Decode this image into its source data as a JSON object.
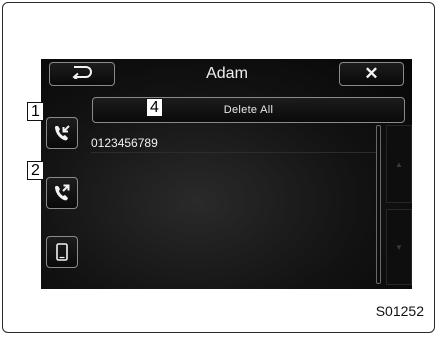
{
  "header": {
    "title": "Adam",
    "back_icon": "return-arrow-icon",
    "close_icon": "close-x-icon",
    "close_glyph": "✕"
  },
  "toolbar": {
    "delete_all_label": "Delete All"
  },
  "sidebar": {
    "items": [
      {
        "icon": "incoming-call-icon",
        "callout": "1"
      },
      {
        "icon": "outgoing-call-icon",
        "callout": "2"
      },
      {
        "icon": "phone-device-icon"
      }
    ]
  },
  "list": {
    "items": [
      {
        "number": "0123456789"
      }
    ]
  },
  "scroll": {
    "up_glyph": "▲",
    "down_glyph": "▼"
  },
  "callouts": {
    "delete_all": "4"
  },
  "figure_code": "S01252",
  "colors": {
    "screen_bg": "#0e0e0e",
    "text": "#f2f2f2",
    "button_border": "#8a8a8a"
  }
}
